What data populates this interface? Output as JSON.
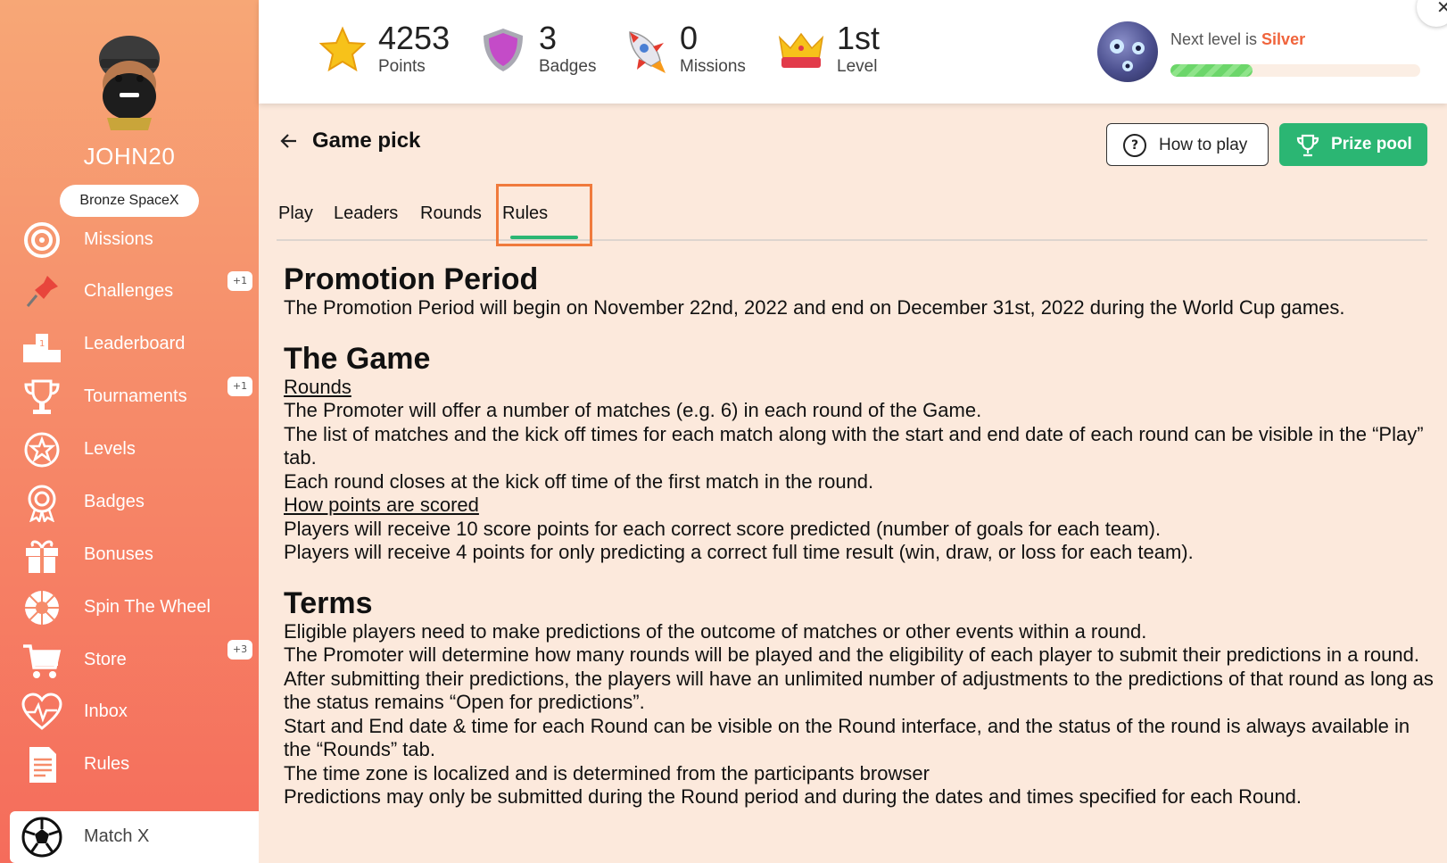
{
  "user": {
    "username": "JOHN20",
    "rank": "Bronze SpaceX"
  },
  "sidebar": {
    "items": [
      {
        "label": "Missions",
        "icon": "target-icon",
        "count": ""
      },
      {
        "label": "Challenges",
        "icon": "pushpin-icon",
        "count": "+1"
      },
      {
        "label": "Leaderboard",
        "icon": "podium-icon",
        "count": ""
      },
      {
        "label": "Tournaments",
        "icon": "trophy-icon",
        "count": "+1"
      },
      {
        "label": "Levels",
        "icon": "star-badge-icon",
        "count": ""
      },
      {
        "label": "Badges",
        "icon": "medal-icon",
        "count": ""
      },
      {
        "label": "Bonuses",
        "icon": "gift-icon",
        "count": ""
      },
      {
        "label": "Spin The Wheel",
        "icon": "wheel-icon",
        "count": ""
      },
      {
        "label": "Store",
        "icon": "cart-icon",
        "count": "+3"
      },
      {
        "label": "Inbox",
        "icon": "heart-pulse-icon",
        "count": ""
      },
      {
        "label": "Rules",
        "icon": "document-icon",
        "count": ""
      },
      {
        "label": "Match X",
        "icon": "soccer-ball-icon",
        "count": ""
      }
    ]
  },
  "stats": {
    "points": {
      "value": "4253",
      "label": "Points",
      "icon": "star-icon"
    },
    "badges": {
      "value": "3",
      "label": "Badges",
      "icon": "shield-icon"
    },
    "missions": {
      "value": "0",
      "label": "Missions",
      "icon": "rocket-icon"
    },
    "level": {
      "value": "1st",
      "label": "Level",
      "icon": "crown-icon"
    }
  },
  "next_level": {
    "prefix": "Next level is ",
    "name": "Silver",
    "progress": 0.33
  },
  "header": {
    "title": "Game pick",
    "how_to_play": "How to play",
    "prize_pool": "Prize pool"
  },
  "tabs": [
    "Play",
    "Leaders",
    "Rounds",
    "Rules"
  ],
  "active_tab": "Rules",
  "rules": {
    "promotion": {
      "heading": "Promotion Period",
      "text": "The Promotion Period will begin on November 22nd, 2022 and end on December 31st, 2022 during the World Cup games."
    },
    "game": {
      "heading": "The Game",
      "rounds_sub": "Rounds",
      "rounds_lines": [
        "The Promoter will offer a number of matches (e.g. 6) in each round of the Game.",
        "The list of matches and the kick off times for each match along with the start and end date of each round can be visible in the “Play” tab.",
        "Each round closes at the kick off time of the first match in the round."
      ],
      "points_sub": "How points are scored",
      "points_lines": [
        "Players will receive 10 score points for each correct score predicted (number of goals for each team).",
        "Players will receive 4 points for only predicting a correct full time result (win, draw, or loss for each team)."
      ]
    },
    "terms": {
      "heading": "Terms",
      "lines": [
        "Eligible players need to make predictions of the outcome of matches or other events within a round.",
        "The Promoter will determine how many rounds will be played and the eligibility of each player to submit their predictions in a round.",
        "After submitting their predictions, the players will have an unlimited number of adjustments to the predictions of that round as long as the status remains “Open for predictions”.",
        "Start and End date & time for each Round can be visible on the Round interface, and the status of the round is always available in the “Rounds” tab.",
        "The time zone is localized and is determined from the participants browser",
        "Predictions may only be submitted during the Round period and during the dates and times specified for each Round."
      ]
    }
  },
  "colors": {
    "accent_green": "#2bb673",
    "highlight_orange": "#f07a3c",
    "silver_text": "#f0643c"
  }
}
